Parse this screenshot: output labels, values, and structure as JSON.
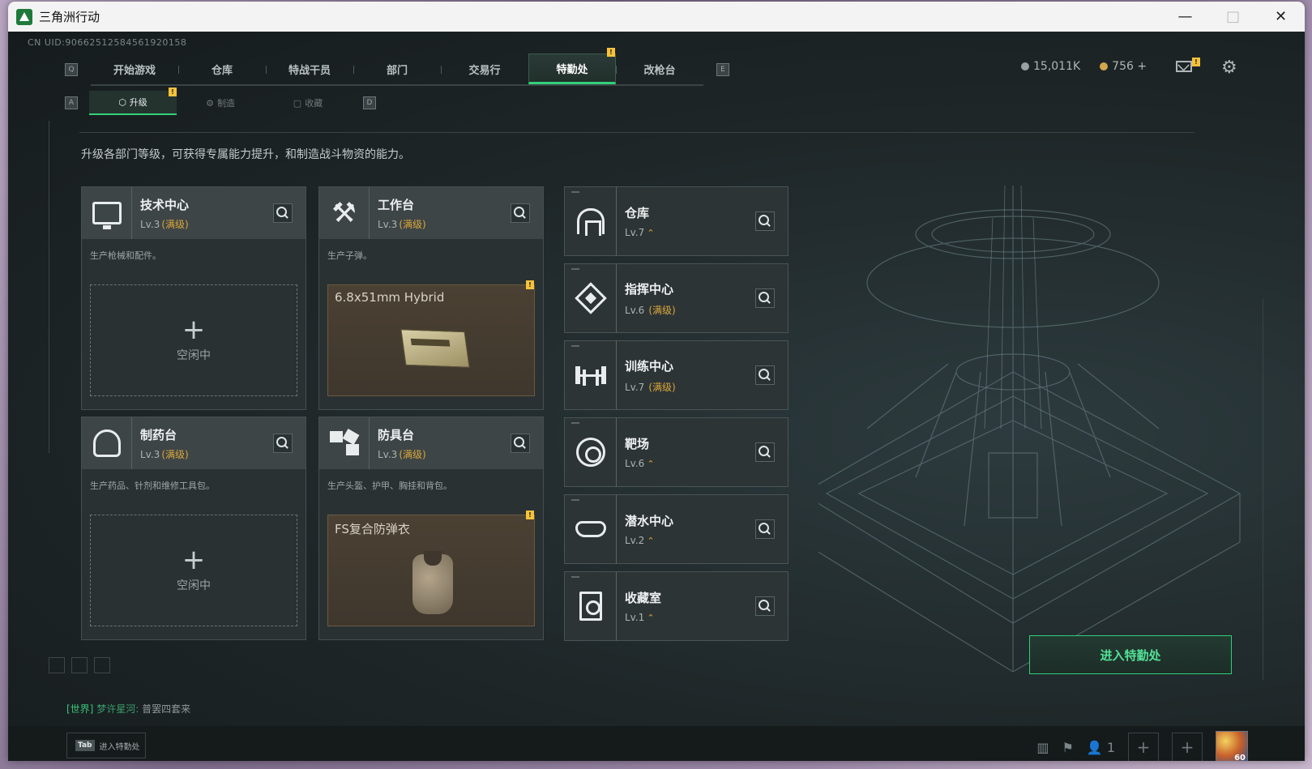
{
  "window": {
    "title": "三角洲行动",
    "minimize": "—",
    "maximize": "□",
    "close": "✕"
  },
  "uid": "CN UID:9066251258456192015​8",
  "nav": {
    "left_key": "Q",
    "right_key": "E",
    "tabs": [
      "开始游戏",
      "仓库",
      "特战干员",
      "部门",
      "交易行",
      "特勤处",
      "改枪台"
    ],
    "active": "特勤处",
    "alert": "!"
  },
  "currency": {
    "silver": "15,011K",
    "gold": "756 +"
  },
  "subnav": {
    "left_key": "A",
    "right_key": "D",
    "tabs": [
      "升级",
      "制造",
      "收藏"
    ],
    "active": "升级",
    "alert": "!"
  },
  "description": "升级各部门等级，可获得专属能力提升，和制造战斗物资的能力。",
  "workshops": [
    {
      "name": "技术中心",
      "level": "Lv.3",
      "maxed": "(满级)",
      "desc": "生产枪械和配件。",
      "slot_plus": "+",
      "slot_state": "空闲中",
      "icon": "monitor-icon"
    },
    {
      "name": "工作台",
      "level": "Lv.3",
      "maxed": "(满级)",
      "desc": "生产子弹。",
      "product": "6.8x51mm Hybrid",
      "icon": "hammer-icon"
    },
    {
      "name": "制药台",
      "level": "Lv.3",
      "maxed": "(满级)",
      "desc": "生产药品、针剂和维修工具包。",
      "slot_plus": "+",
      "slot_state": "空闲中",
      "icon": "microscope-icon"
    },
    {
      "name": "防具台",
      "level": "Lv.3",
      "maxed": "(满级)",
      "desc": "生产头盔、护甲、胸挂和背包。",
      "product": "FS复合防弹衣",
      "icon": "armor-icon"
    }
  ],
  "departments": [
    {
      "name": "仓库",
      "level": "Lv.7",
      "upgrade": "⌃",
      "maxed": "",
      "icon": "garage-icon"
    },
    {
      "name": "指挥中心",
      "level": "Lv.6",
      "upgrade": "",
      "maxed": "(满级)",
      "icon": "command-icon"
    },
    {
      "name": "训练中心",
      "level": "Lv.7",
      "upgrade": "",
      "maxed": "(满级)",
      "icon": "dumbbell-icon"
    },
    {
      "name": "靶场",
      "level": "Lv.6",
      "upgrade": "⌃",
      "maxed": "",
      "icon": "target-icon"
    },
    {
      "name": "潜水中心",
      "level": "Lv.2",
      "upgrade": "⌃",
      "maxed": "",
      "icon": "goggles-icon"
    },
    {
      "name": "收藏室",
      "level": "Lv.1",
      "upgrade": "⌃",
      "maxed": "",
      "icon": "vault-icon"
    }
  ],
  "enter_button": "进入特勤处",
  "chat": {
    "channel": "[世界]",
    "user": "梦许星河:",
    "message": "普罢四套来"
  },
  "bottom": {
    "tab_key": "Tab",
    "tab_label": "进入特勤处",
    "friends_count": "1",
    "level": "60"
  }
}
